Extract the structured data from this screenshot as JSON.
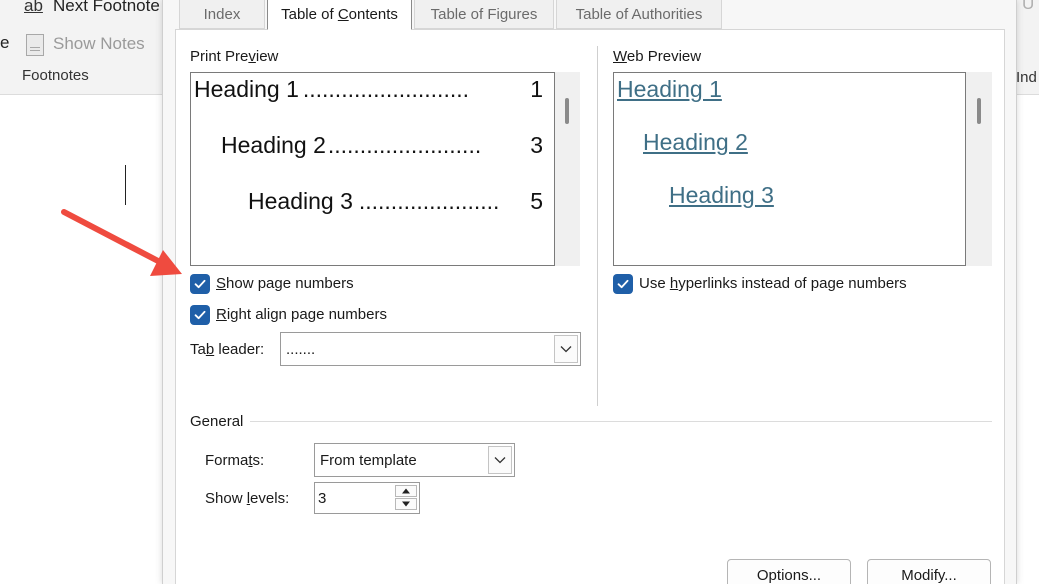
{
  "ribbon": {
    "left_cut_text": "e",
    "ab_icon_text": "ab",
    "next_footnote_label": "Next Footnote",
    "show_notes_label": "Show Notes",
    "group_label": "Footnotes",
    "right_cut_text": "Ind",
    "right_top_text": "U"
  },
  "dialog": {
    "tabs": [
      {
        "label": "Index",
        "active": false
      },
      {
        "label_pre": "Table of ",
        "label_u": "C",
        "label_post": "ontents",
        "active": true
      },
      {
        "label": "Table of Figures",
        "active": false
      },
      {
        "label": "Table of Authorities",
        "active": false
      }
    ],
    "print_preview": {
      "label_pre": "Print Pre",
      "label_u": "v",
      "label_post": "iew",
      "entries": [
        {
          "text": "Heading 1",
          "dots": "..........................",
          "page": "1"
        },
        {
          "text": "Heading 2",
          "dots": "........................",
          "page": "3"
        },
        {
          "text": "Heading 3",
          "dots": "......................",
          "page": "5"
        }
      ],
      "show_page_numbers": {
        "checked": true,
        "label_u": "S",
        "label_rest": "how page numbers"
      },
      "right_align": {
        "checked": true,
        "label_u": "R",
        "label_rest": "ight align page numbers"
      },
      "tab_leader": {
        "label_pre": "Ta",
        "label_u": "b",
        "label_post": " leader:",
        "value": "......."
      }
    },
    "web_preview": {
      "label_u": "W",
      "label_rest": "eb Preview",
      "entries": [
        "Heading 1",
        "Heading 2",
        "Heading 3"
      ],
      "use_hyperlinks": {
        "checked": true,
        "label_pre": "Use ",
        "label_u": "h",
        "label_post": "yperlinks instead of page numbers"
      }
    },
    "general": {
      "label": "General",
      "formats": {
        "label_pre": "Forma",
        "label_u": "t",
        "label_post": "s:",
        "value": "From template"
      },
      "show_levels": {
        "label_pre": "Show ",
        "label_u": "l",
        "label_post": "evels:",
        "value": "3"
      }
    },
    "buttons": {
      "options": "Options...",
      "modify": "Modify..."
    }
  },
  "colors": {
    "accent": "#1f5fa8",
    "link": "#3f6f86",
    "arrow": "#ef4b3f"
  }
}
